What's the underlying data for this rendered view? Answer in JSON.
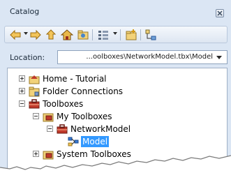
{
  "window": {
    "title": "Catalog"
  },
  "toolbar": {
    "buttons": [
      {
        "name": "back-icon"
      },
      {
        "name": "forward-icon"
      },
      {
        "name": "up-one-level-icon"
      },
      {
        "name": "home-icon"
      },
      {
        "name": "connect-folder-icon"
      },
      {
        "name": "view-options-icon"
      },
      {
        "name": "new-folder-icon"
      },
      {
        "name": "toggle-contents-icon"
      }
    ]
  },
  "location": {
    "label": "Location:",
    "value": "...oolboxes\\NetworkModel.tbx\\Model"
  },
  "tree": {
    "items": [
      {
        "label": "Home - Tutorial",
        "icon": "home-folder-icon",
        "expander": "plus"
      },
      {
        "label": "Folder Connections",
        "icon": "folder-connection-icon",
        "expander": "plus"
      },
      {
        "label": "Toolboxes",
        "icon": "toolboxes-icon",
        "expander": "minus"
      },
      {
        "label": "My Toolboxes",
        "icon": "toolbox-folder-icon",
        "expander": "minus"
      },
      {
        "label": "NetworkModel",
        "icon": "toolbox-icon",
        "expander": "minus"
      },
      {
        "label": "Model",
        "icon": "model-icon",
        "selected": true
      },
      {
        "label": "System Toolboxes",
        "icon": "toolbox-folder-icon",
        "expander": "plus"
      }
    ]
  },
  "colors": {
    "selection": "#3399ff",
    "frame": "#dbe6f4"
  }
}
